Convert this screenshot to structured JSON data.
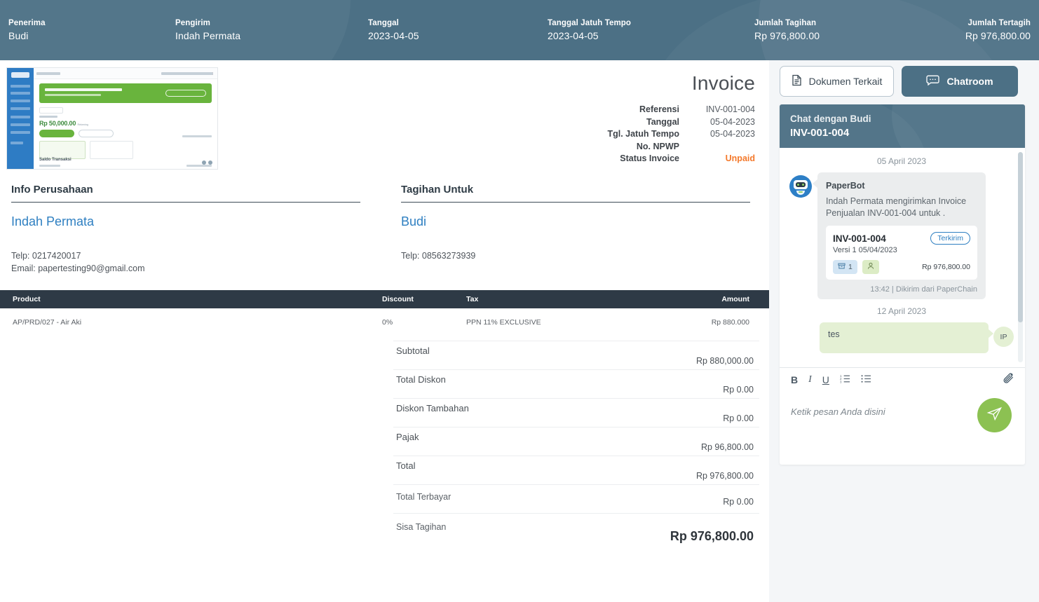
{
  "header": {
    "cells": [
      {
        "label": "Penerima",
        "value": "Budi"
      },
      {
        "label": "Pengirim",
        "value": "Indah Permata"
      },
      {
        "label": "Tanggal",
        "value": "2023-04-05"
      },
      {
        "label": "Tanggal Jatuh Tempo",
        "value": "2023-04-05"
      },
      {
        "label": "Jumlah Tagihan",
        "value": "Rp 976,800.00"
      },
      {
        "label": "Jumlah Tertagih",
        "value": "Rp 976,800.00"
      }
    ],
    "bg_color": "#4c7085"
  },
  "document": {
    "title": "Invoice",
    "meta": [
      {
        "key": "Referensi",
        "value": "INV-001-004"
      },
      {
        "key": "Tanggal",
        "value": "05-04-2023"
      },
      {
        "key": "Tgl. Jatuh Tempo",
        "value": "05-04-2023"
      },
      {
        "key": "No. NPWP",
        "value": ""
      },
      {
        "key": "Status Invoice",
        "value": "Unpaid",
        "status": true
      }
    ],
    "status_color": "#f4792b",
    "company": {
      "heading": "Info Perusahaan",
      "name": "Indah Permata",
      "lines": [
        "Telp: 0217420017",
        "Email: papertesting90@gmail.com"
      ]
    },
    "billto": {
      "heading": "Tagihan Untuk",
      "name": "Budi",
      "lines": [
        "Telp: 08563273939"
      ]
    },
    "table": {
      "columns": [
        "Product",
        "Discount",
        "Tax",
        "Amount"
      ],
      "rows": [
        {
          "product": "AP/PRD/027 - Air Aki",
          "discount": "0%",
          "tax": "PPN 11% EXCLUSIVE",
          "amount": "Rp 880.000"
        }
      ]
    },
    "totals": [
      {
        "label": "Subtotal",
        "value": "Rp 880,000.00"
      },
      {
        "label": "Total Diskon",
        "value": "Rp 0.00"
      },
      {
        "label": "Diskon Tambahan",
        "value": "Rp 0.00"
      },
      {
        "label": "Pajak",
        "value": "Rp 96,800.00"
      },
      {
        "label": "Total",
        "value": "Rp 976,800.00"
      },
      {
        "label": "Total Terbayar",
        "value": "Rp 0.00"
      },
      {
        "label": "Sisa Tagihan",
        "value": "Rp 976,800.00"
      }
    ]
  },
  "rightpanel": {
    "buttons": {
      "documents": "Dokumen Terkait",
      "chatroom": "Chatroom"
    },
    "chat": {
      "header_line1": "Chat dengan Budi",
      "header_line2": "INV-001-004",
      "dates": {
        "first": "05 April 2023",
        "second": "12 April 2023"
      },
      "incoming": {
        "sender": "PaperBot",
        "text": "Indah Permata mengirimkan Invoice Penjualan INV-001-004 untuk .",
        "card": {
          "number": "INV-001-004",
          "version": "Versi 1   05/04/2023",
          "status": "Terkirim",
          "doc_count": "1",
          "amount": "Rp 976,800.00"
        },
        "meta": "13:42 | Dikirim dari PaperChain"
      },
      "outgoing": {
        "text": "tes",
        "avatar_initials": "IP"
      },
      "composer": {
        "placeholder": "Ketik pesan Anda disini",
        "tools": [
          "B",
          "I",
          "U",
          "ordered-list",
          "bullet-list"
        ]
      }
    },
    "accent_green": "#8cc152"
  }
}
